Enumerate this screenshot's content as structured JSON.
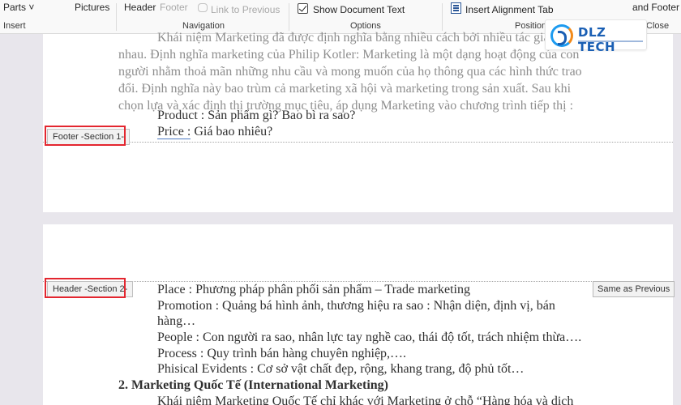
{
  "ribbon": {
    "parts": "Parts",
    "pictures": "Pictures",
    "header": "Header",
    "footer": "Footer",
    "link_to_previous": "Link to Previous",
    "show_document_text": "Show Document Text",
    "insert_alignment_tab": "Insert Alignment Tab",
    "header_and_footer": "and Footer",
    "groups": {
      "insert": "Insert",
      "navigation": "Navigation",
      "options": "Options",
      "position": "Position",
      "close": "Close"
    }
  },
  "logo": {
    "text": "DLZ TECH"
  },
  "page1": {
    "lines": [
      "Khái niệm Marketing đã được định nghĩa bằng nhiều cách bởi nhiều tác giả",
      "nhau. Định nghĩa marketing của Philip Kotler: Marketing là một dạng hoạt động của con",
      "người nhằm thoả mãn những nhu cầu và mong muốn của họ thông qua các hình thức trao",
      "đổi. Định nghĩa này bao trùm cả marketing xã hội và marketing trong sản xuất. Sau khi",
      "chọn lựa và xác định thị trường mục tiêu, áp dụng Marketing vào chương trình tiếp thị :"
    ],
    "product_line": "Product : Sản phẩm gì? Bao bì ra sao?",
    "price_label": "Price :",
    "price_rest": " Giá bao nhiêu?",
    "footer_tag": "Footer -Section 1-"
  },
  "page2": {
    "header_tag": "Header -Section 2-",
    "same_as_previous": "Same as Previous",
    "lines": [
      "Place : Phương pháp phân phối sản phẩm – Trade marketing",
      "Promotion : Quảng bá hình ảnh, thương hiệu ra sao : Nhận diện, định vị, bán",
      "hàng…",
      "People : Con người ra sao, nhân lực tay nghề cao, thái độ tốt, trách nhiệm thừa….",
      "Process : Quy trình bán hàng chuyên nghiệp,….",
      "Phisical Evidents : Cơ sở vật chất đẹp, rộng, khang trang, độ phủ tốt…"
    ],
    "heading": "2. Marketing Quốc Tế (International Marketing)",
    "last_line": "Khái niệm Marketing Quốc Tế chỉ khác với Marketing ở chỗ “Hàng hóa và dịch"
  }
}
